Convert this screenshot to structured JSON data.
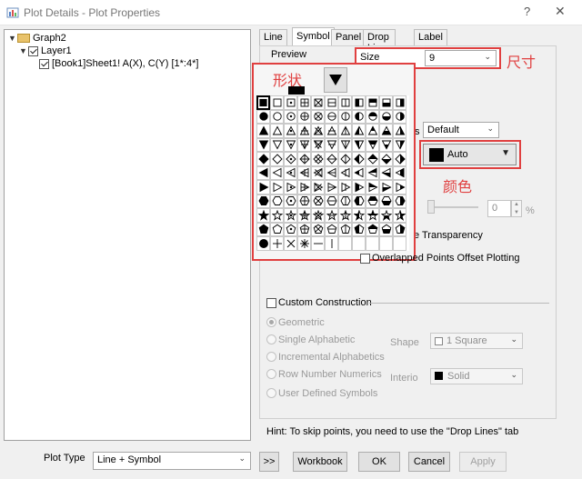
{
  "window": {
    "title": "Plot Details - Plot Properties",
    "help": "?",
    "close": "✕"
  },
  "tree": {
    "graph": "Graph2",
    "layer": "Layer1",
    "plot": "[Book1]Sheet1! A(X), C(Y) [1*:4*]"
  },
  "tabs": [
    {
      "label": "Line",
      "active": false
    },
    {
      "label": "Symbol",
      "active": true
    },
    {
      "label": "Panel",
      "active": false
    },
    {
      "label": "Drop Lines",
      "active": false
    },
    {
      "label": "Label",
      "active": false
    }
  ],
  "symbol": {
    "preview_label": "Preview",
    "size_label": "Size",
    "size_value": "9",
    "edge_value": "Default",
    "edge_label_tail": "s",
    "color_value": "Auto",
    "spin_value": "0",
    "spin_unit": "%",
    "transparency_label": "e Transparency",
    "overlapped_label": "Overlapped Points Offset Plotting"
  },
  "annotations": {
    "shape": "形状",
    "size": "尺寸",
    "color": "颜色"
  },
  "custom": {
    "checkbox_label": "Custom Construction",
    "options": [
      "Geometric",
      "Single Alphabetic",
      "Incremental Alphabetics",
      "Row Number Numerics",
      "User Defined Symbols"
    ],
    "shape_label": "Shape",
    "shape_value": "1 Square",
    "interior_label": "Interio",
    "interior_value": "Solid"
  },
  "hint": "Hint: To skip points, you need to use the \"Drop Lines\" tab",
  "footer": {
    "plot_type_label": "Plot Type",
    "plot_type_value": "Line + Symbol",
    "expand": ">>",
    "workbook": "Workbook",
    "ok": "OK",
    "cancel": "Cancel",
    "apply": "Apply"
  },
  "colors": {
    "annotation": "#e04040",
    "panel": "#f0f0f0"
  }
}
